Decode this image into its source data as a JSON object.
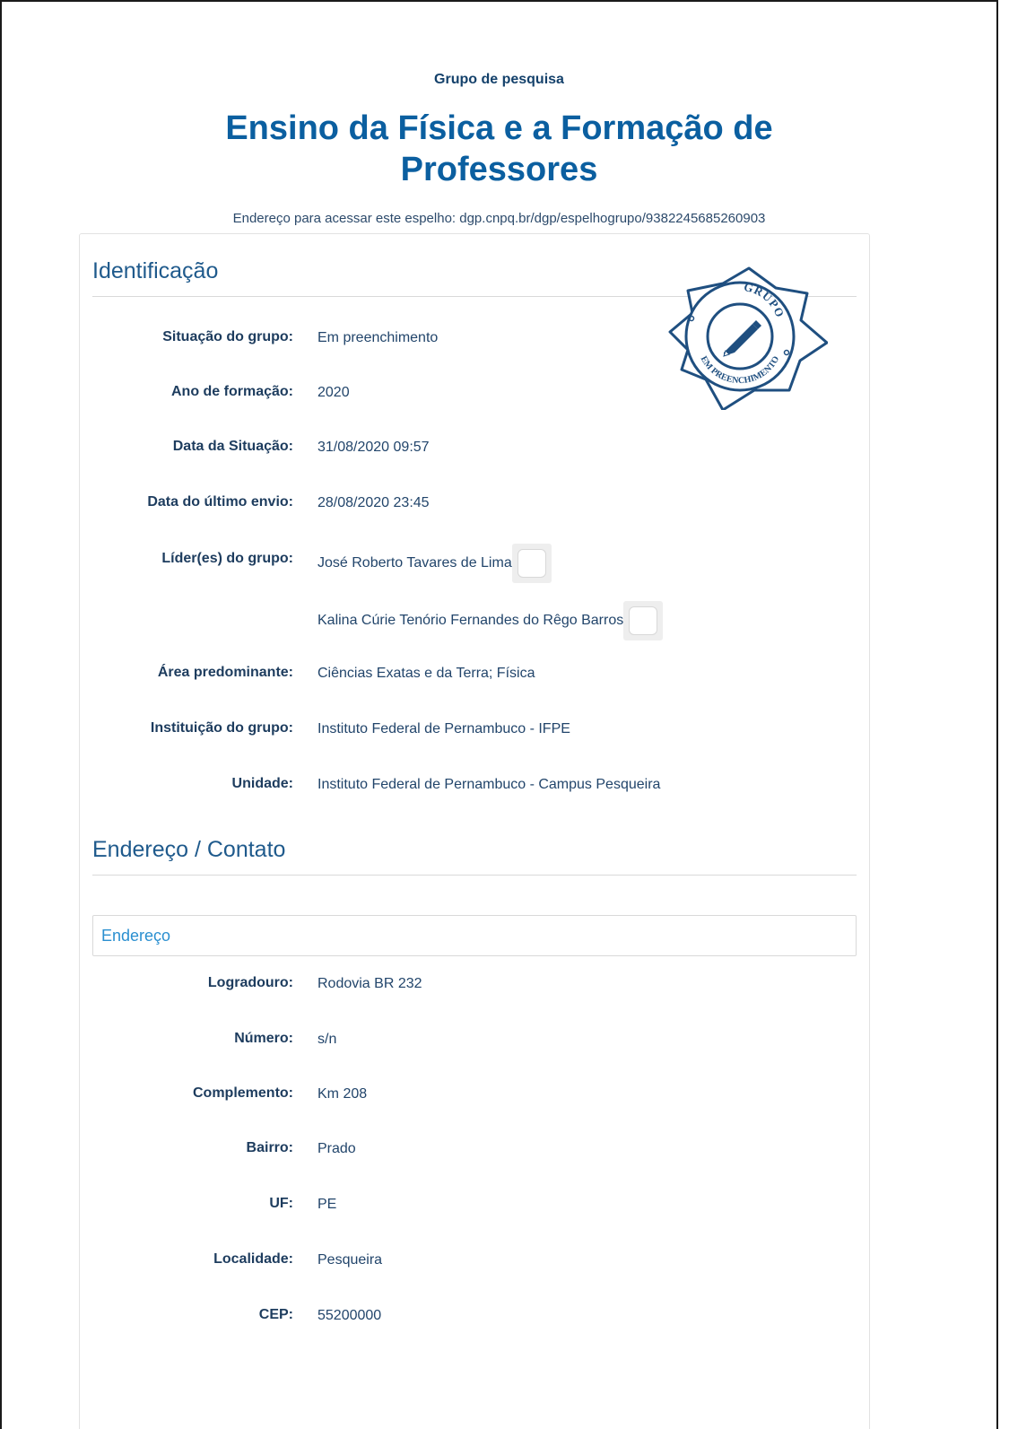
{
  "header": {
    "kicker": "Grupo de pesquisa",
    "title_line1": "Ensino da Física e a Formação de",
    "title_line2": "Professores",
    "mirror_url": "Endereço para acessar este espelho: dgp.cnpq.br/dgp/espelhogrupo/9382245685260903"
  },
  "stamp": {
    "top_text": "GRUPO",
    "bottom_text": "EM PREENCHIMENTO",
    "icon": "pencil-icon",
    "color": "#1f4f80"
  },
  "identificacao": {
    "title": "Identificação",
    "situacao": {
      "label": "Situação do grupo:",
      "value": "Em preenchimento"
    },
    "ano": {
      "label": "Ano de formação:",
      "value": "2020"
    },
    "data_situacao": {
      "label": "Data da Situação:",
      "value": "31/08/2020 09:57"
    },
    "data_envio": {
      "label": "Data do último envio:",
      "value": "28/08/2020 23:45"
    },
    "lideres": {
      "label": "Líder(es) do grupo:",
      "items": [
        "José Roberto Tavares de Lima",
        "Kalina Cúrie Tenório Fernandes do Rêgo Barros"
      ]
    },
    "area": {
      "label": "Área predominante:",
      "value": "Ciências Exatas e da Terra; Física"
    },
    "instituicao": {
      "label": "Instituição do grupo:",
      "value": "Instituto Federal de Pernambuco - IFPE"
    },
    "unidade": {
      "label": "Unidade:",
      "value": "Instituto Federal de Pernambuco - Campus Pesqueira"
    }
  },
  "contato": {
    "title": "Endereço / Contato",
    "subpanel_title": "Endereço",
    "logradouro": {
      "label": "Logradouro:",
      "value": "Rodovia BR 232"
    },
    "numero": {
      "label": "Número:",
      "value": "s/n"
    },
    "complemento": {
      "label": "Complemento:",
      "value": "Km 208"
    },
    "bairro": {
      "label": "Bairro:",
      "value": "Prado"
    },
    "uf": {
      "label": "UF:",
      "value": "PE"
    },
    "localidade": {
      "label": "Localidade:",
      "value": "Pesqueira"
    },
    "cep": {
      "label": "CEP:",
      "value": "55200000"
    }
  },
  "colors": {
    "title": "#0b5fa0",
    "section_title": "#1f5a8c",
    "subpanel_link": "#2a8fd0"
  }
}
